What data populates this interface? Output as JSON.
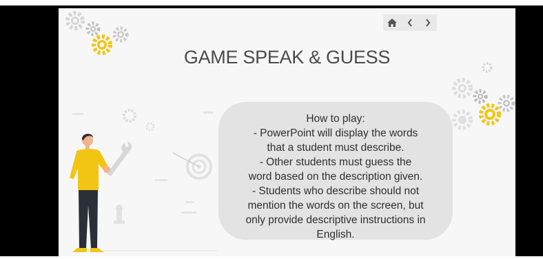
{
  "slide": {
    "title": "GAME SPEAK & GUESS",
    "instructions": [
      "How to play:",
      "- PowerPoint will display the words",
      "that a student must describe.",
      "- Other students must guess the",
      "word based on the description given.",
      "- Students who describe should not",
      "mention the words on the screen, but",
      "only provide descriptive instructions in",
      "English."
    ]
  },
  "nav": {
    "home_icon": "home-icon",
    "prev_icon": "chevron-left-icon",
    "next_icon": "chevron-right-icon"
  },
  "colors": {
    "accent_yellow": "#f2c515",
    "gear_gray": "#cccccc",
    "bubble_bg": "#e3e3e3",
    "title_text": "#4a4a4a"
  }
}
